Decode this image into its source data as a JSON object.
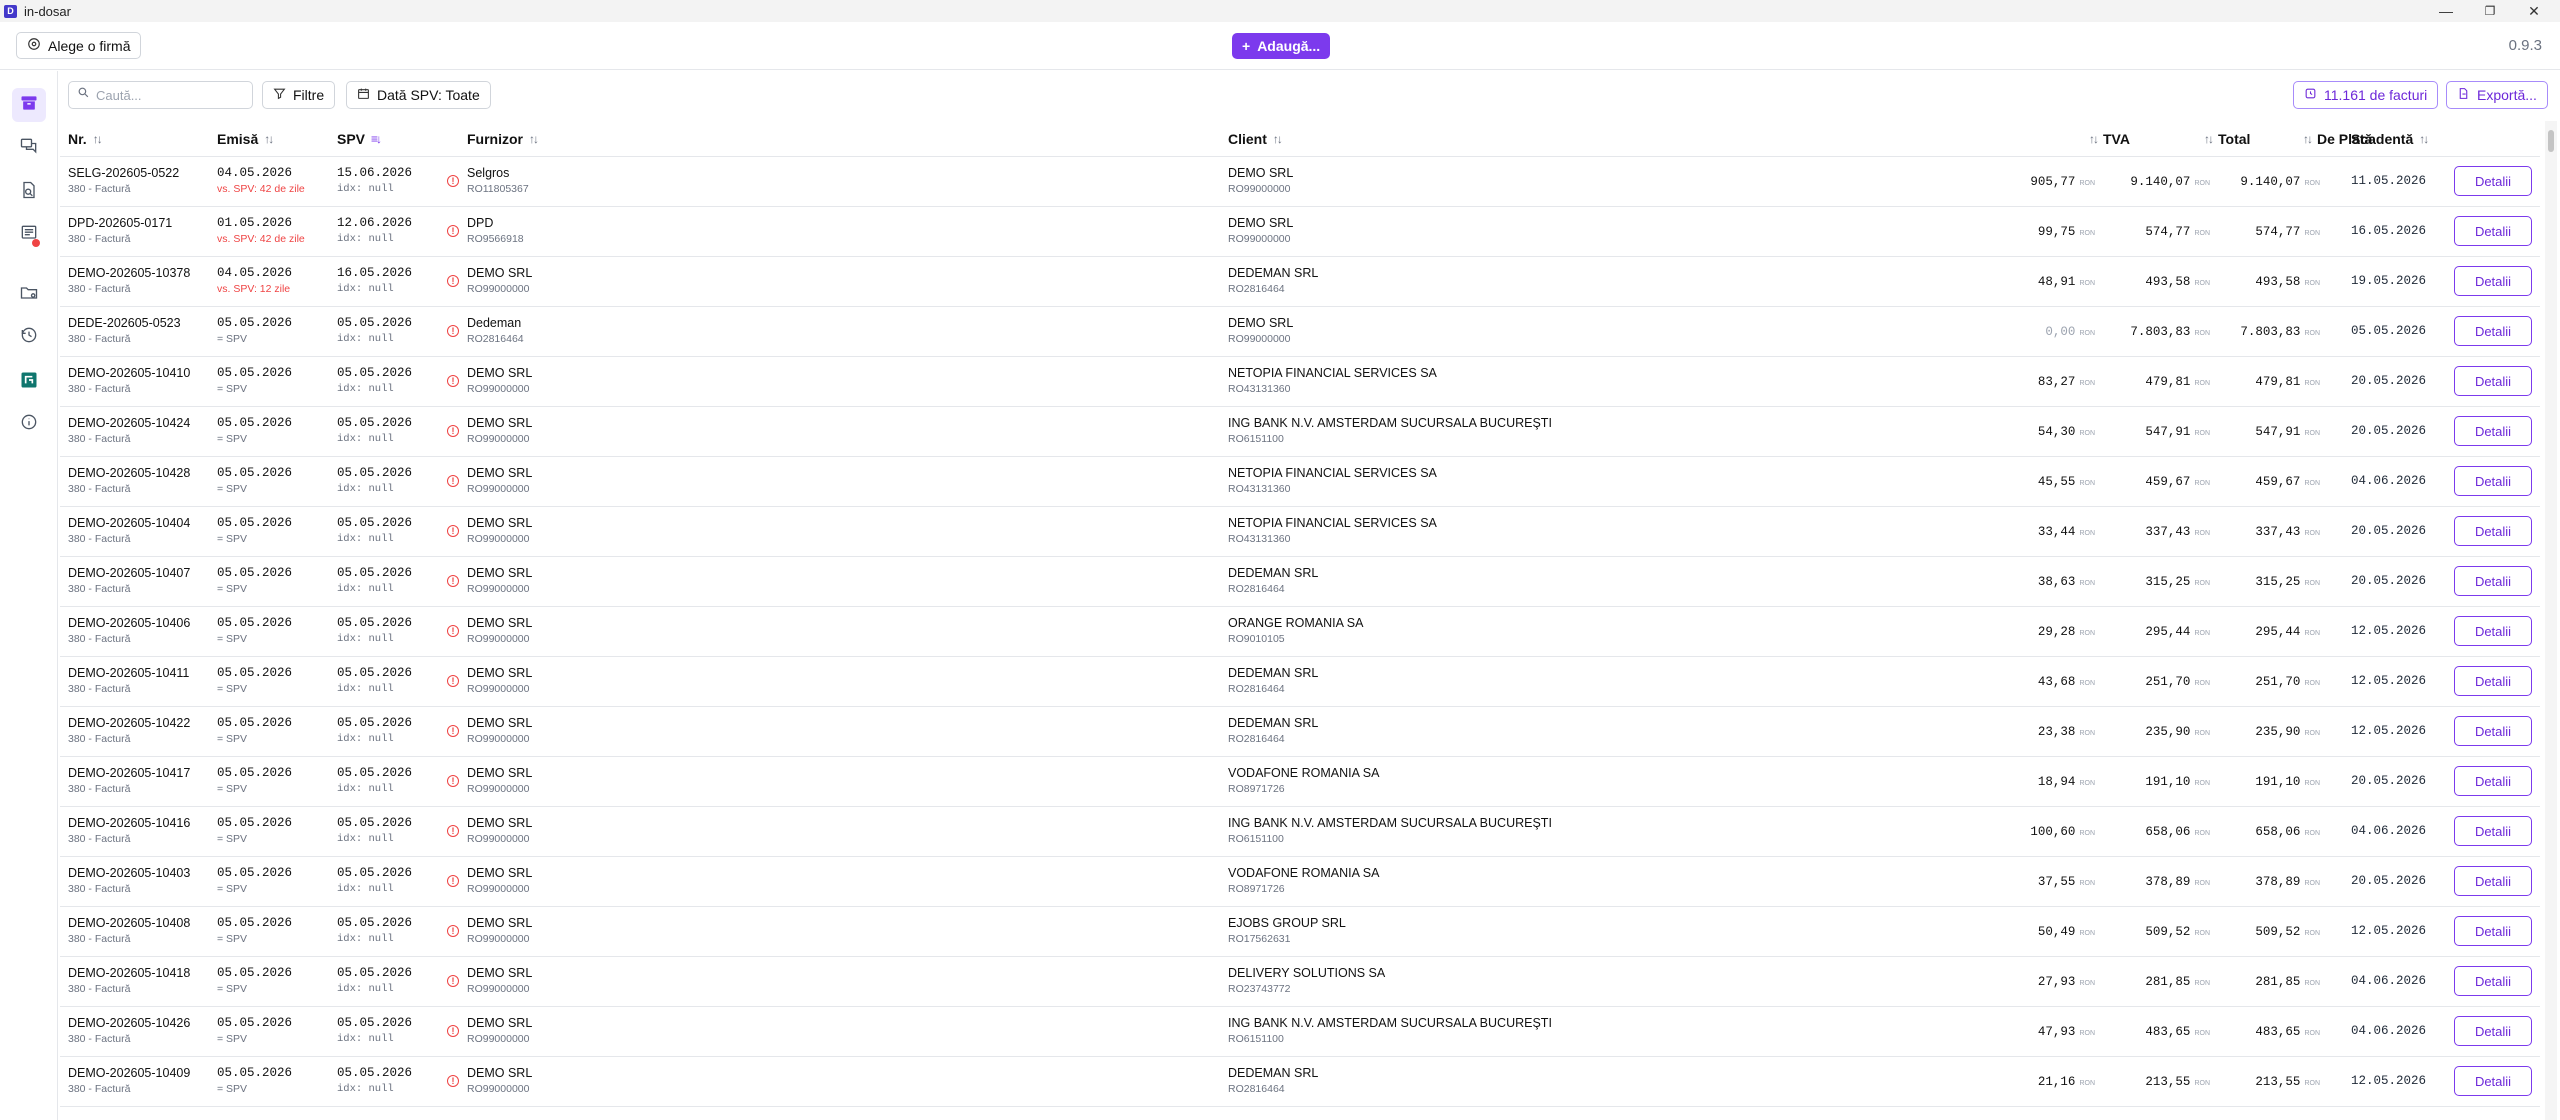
{
  "window": {
    "title": "in-dosar",
    "min": "—",
    "max": "❐",
    "close": "✕"
  },
  "topbar": {
    "company_button": "Alege o firmă",
    "add_button": "Adaugă...",
    "version": "0.9.3"
  },
  "toolbar": {
    "search_placeholder": "Caută...",
    "filters_button": "Filtre",
    "date_button": "Dată SPV: Toate",
    "invoices_count_button": "11.161 de facturi",
    "export_button": "Exportă..."
  },
  "columns": {
    "nr": "Nr.",
    "emisa": "Emisă",
    "spv": "SPV",
    "furnizor": "Furnizor",
    "client": "Client",
    "tva": "TVA",
    "total": "Total",
    "de_plata": "De Plată",
    "scadenta": "Scadentă",
    "sort_icon": "↑↓"
  },
  "currency": "RON",
  "detail_label": "Detalii",
  "rows": [
    {
      "nr": "SELG-202605-0522",
      "type": "380 - Factură",
      "emisa": "04.05.2026",
      "emisa_sub": "vs. SPV: 42 de zile",
      "emisa_warn": true,
      "spv": "15.06.2026",
      "spv_sub": "idx: null",
      "furnizor": "Selgros",
      "furnizor_cui": "RO11805367",
      "client": "DEMO SRL",
      "client_cui": "RO99000000",
      "tva": "905,77",
      "total": "9.140,07",
      "de_plata": "9.140,07",
      "scadenta": "11.05.2026"
    },
    {
      "nr": "DPD-202605-0171",
      "type": "380 - Factură",
      "emisa": "01.05.2026",
      "emisa_sub": "vs. SPV: 42 de zile",
      "emisa_warn": true,
      "spv": "12.06.2026",
      "spv_sub": "idx: null",
      "furnizor": "DPD",
      "furnizor_cui": "RO9566918",
      "client": "DEMO SRL",
      "client_cui": "RO99000000",
      "tva": "99,75",
      "total": "574,77",
      "de_plata": "574,77",
      "scadenta": "16.05.2026"
    },
    {
      "nr": "DEMO-202605-10378",
      "type": "380 - Factură",
      "emisa": "04.05.2026",
      "emisa_sub": "vs. SPV: 12 zile",
      "emisa_warn": true,
      "spv": "16.05.2026",
      "spv_sub": "idx: null",
      "furnizor": "DEMO SRL",
      "furnizor_cui": "RO99000000",
      "client": "DEDEMAN SRL",
      "client_cui": "RO2816464",
      "tva": "48,91",
      "total": "493,58",
      "de_plata": "493,58",
      "scadenta": "19.05.2026"
    },
    {
      "nr": "DEDE-202605-0523",
      "type": "380 - Factură",
      "emisa": "05.05.2026",
      "emisa_sub": "= SPV",
      "emisa_warn": false,
      "spv": "05.05.2026",
      "spv_sub": "idx: null",
      "furnizor": "Dedeman",
      "furnizor_cui": "RO2816464",
      "client": "DEMO SRL",
      "client_cui": "RO99000000",
      "tva": "0,00",
      "tva_zero": true,
      "total": "7.803,83",
      "de_plata": "7.803,83",
      "scadenta": "05.05.2026"
    },
    {
      "nr": "DEMO-202605-10410",
      "type": "380 - Factură",
      "emisa": "05.05.2026",
      "emisa_sub": "= SPV",
      "emisa_warn": false,
      "spv": "05.05.2026",
      "spv_sub": "idx: null",
      "furnizor": "DEMO SRL",
      "furnizor_cui": "RO99000000",
      "client": "NETOPIA FINANCIAL SERVICES SA",
      "client_cui": "RO43131360",
      "tva": "83,27",
      "total": "479,81",
      "de_plata": "479,81",
      "scadenta": "20.05.2026"
    },
    {
      "nr": "DEMO-202605-10424",
      "type": "380 - Factură",
      "emisa": "05.05.2026",
      "emisa_sub": "= SPV",
      "emisa_warn": false,
      "spv": "05.05.2026",
      "spv_sub": "idx: null",
      "furnizor": "DEMO SRL",
      "furnizor_cui": "RO99000000",
      "client": "ING BANK N.V. AMSTERDAM SUCURSALA BUCUREŞTI",
      "client_cui": "RO6151100",
      "tva": "54,30",
      "total": "547,91",
      "de_plata": "547,91",
      "scadenta": "20.05.2026"
    },
    {
      "nr": "DEMO-202605-10428",
      "type": "380 - Factură",
      "emisa": "05.05.2026",
      "emisa_sub": "= SPV",
      "emisa_warn": false,
      "spv": "05.05.2026",
      "spv_sub": "idx: null",
      "furnizor": "DEMO SRL",
      "furnizor_cui": "RO99000000",
      "client": "NETOPIA FINANCIAL SERVICES SA",
      "client_cui": "RO43131360",
      "tva": "45,55",
      "total": "459,67",
      "de_plata": "459,67",
      "scadenta": "04.06.2026"
    },
    {
      "nr": "DEMO-202605-10404",
      "type": "380 - Factură",
      "emisa": "05.05.2026",
      "emisa_sub": "= SPV",
      "emisa_warn": false,
      "spv": "05.05.2026",
      "spv_sub": "idx: null",
      "furnizor": "DEMO SRL",
      "furnizor_cui": "RO99000000",
      "client": "NETOPIA FINANCIAL SERVICES SA",
      "client_cui": "RO43131360",
      "tva": "33,44",
      "total": "337,43",
      "de_plata": "337,43",
      "scadenta": "20.05.2026"
    },
    {
      "nr": "DEMO-202605-10407",
      "type": "380 - Factură",
      "emisa": "05.05.2026",
      "emisa_sub": "= SPV",
      "emisa_warn": false,
      "spv": "05.05.2026",
      "spv_sub": "idx: null",
      "furnizor": "DEMO SRL",
      "furnizor_cui": "RO99000000",
      "client": "DEDEMAN SRL",
      "client_cui": "RO2816464",
      "tva": "38,63",
      "total": "315,25",
      "de_plata": "315,25",
      "scadenta": "20.05.2026"
    },
    {
      "nr": "DEMO-202605-10406",
      "type": "380 - Factură",
      "emisa": "05.05.2026",
      "emisa_sub": "= SPV",
      "emisa_warn": false,
      "spv": "05.05.2026",
      "spv_sub": "idx: null",
      "furnizor": "DEMO SRL",
      "furnizor_cui": "RO99000000",
      "client": "ORANGE ROMANIA SA",
      "client_cui": "RO9010105",
      "tva": "29,28",
      "total": "295,44",
      "de_plata": "295,44",
      "scadenta": "12.05.2026"
    },
    {
      "nr": "DEMO-202605-10411",
      "type": "380 - Factură",
      "emisa": "05.05.2026",
      "emisa_sub": "= SPV",
      "emisa_warn": false,
      "spv": "05.05.2026",
      "spv_sub": "idx: null",
      "furnizor": "DEMO SRL",
      "furnizor_cui": "RO99000000",
      "client": "DEDEMAN SRL",
      "client_cui": "RO2816464",
      "tva": "43,68",
      "total": "251,70",
      "de_plata": "251,70",
      "scadenta": "12.05.2026"
    },
    {
      "nr": "DEMO-202605-10422",
      "type": "380 - Factură",
      "emisa": "05.05.2026",
      "emisa_sub": "= SPV",
      "emisa_warn": false,
      "spv": "05.05.2026",
      "spv_sub": "idx: null",
      "furnizor": "DEMO SRL",
      "furnizor_cui": "RO99000000",
      "client": "DEDEMAN SRL",
      "client_cui": "RO2816464",
      "tva": "23,38",
      "total": "235,90",
      "de_plata": "235,90",
      "scadenta": "12.05.2026"
    },
    {
      "nr": "DEMO-202605-10417",
      "type": "380 - Factură",
      "emisa": "05.05.2026",
      "emisa_sub": "= SPV",
      "emisa_warn": false,
      "spv": "05.05.2026",
      "spv_sub": "idx: null",
      "furnizor": "DEMO SRL",
      "furnizor_cui": "RO99000000",
      "client": "VODAFONE ROMANIA SA",
      "client_cui": "RO8971726",
      "tva": "18,94",
      "total": "191,10",
      "de_plata": "191,10",
      "scadenta": "20.05.2026"
    },
    {
      "nr": "DEMO-202605-10416",
      "type": "380 - Factură",
      "emisa": "05.05.2026",
      "emisa_sub": "= SPV",
      "emisa_warn": false,
      "spv": "05.05.2026",
      "spv_sub": "idx: null",
      "furnizor": "DEMO SRL",
      "furnizor_cui": "RO99000000",
      "client": "ING BANK N.V. AMSTERDAM SUCURSALA BUCUREŞTI",
      "client_cui": "RO6151100",
      "tva": "100,60",
      "total": "658,06",
      "de_plata": "658,06",
      "scadenta": "04.06.2026"
    },
    {
      "nr": "DEMO-202605-10403",
      "type": "380 - Factură",
      "emisa": "05.05.2026",
      "emisa_sub": "= SPV",
      "emisa_warn": false,
      "spv": "05.05.2026",
      "spv_sub": "idx: null",
      "furnizor": "DEMO SRL",
      "furnizor_cui": "RO99000000",
      "client": "VODAFONE ROMANIA SA",
      "client_cui": "RO8971726",
      "tva": "37,55",
      "total": "378,89",
      "de_plata": "378,89",
      "scadenta": "20.05.2026"
    },
    {
      "nr": "DEMO-202605-10408",
      "type": "380 - Factură",
      "emisa": "05.05.2026",
      "emisa_sub": "= SPV",
      "emisa_warn": false,
      "spv": "05.05.2026",
      "spv_sub": "idx: null",
      "furnizor": "DEMO SRL",
      "furnizor_cui": "RO99000000",
      "client": "EJOBS GROUP SRL",
      "client_cui": "RO17562631",
      "tva": "50,49",
      "total": "509,52",
      "de_plata": "509,52",
      "scadenta": "12.05.2026"
    },
    {
      "nr": "DEMO-202605-10418",
      "type": "380 - Factură",
      "emisa": "05.05.2026",
      "emisa_sub": "= SPV",
      "emisa_warn": false,
      "spv": "05.05.2026",
      "spv_sub": "idx: null",
      "furnizor": "DEMO SRL",
      "furnizor_cui": "RO99000000",
      "client": "DELIVERY SOLUTIONS SA",
      "client_cui": "RO23743772",
      "tva": "27,93",
      "total": "281,85",
      "de_plata": "281,85",
      "scadenta": "04.06.2026"
    },
    {
      "nr": "DEMO-202605-10426",
      "type": "380 - Factură",
      "emisa": "05.05.2026",
      "emisa_sub": "= SPV",
      "emisa_warn": false,
      "spv": "05.05.2026",
      "spv_sub": "idx: null",
      "furnizor": "DEMO SRL",
      "furnizor_cui": "RO99000000",
      "client": "ING BANK N.V. AMSTERDAM SUCURSALA BUCUREŞTI",
      "client_cui": "RO6151100",
      "tva": "47,93",
      "total": "483,65",
      "de_plata": "483,65",
      "scadenta": "04.06.2026"
    },
    {
      "nr": "DEMO-202605-10409",
      "type": "380 - Factură",
      "emisa": "05.05.2026",
      "emisa_sub": "= SPV",
      "emisa_warn": false,
      "spv": "05.05.2026",
      "spv_sub": "idx: null",
      "furnizor": "DEMO SRL",
      "furnizor_cui": "RO99000000",
      "client": "DEDEMAN SRL",
      "client_cui": "RO2816464",
      "tva": "21,16",
      "total": "213,55",
      "de_plata": "213,55",
      "scadenta": "12.05.2026"
    }
  ],
  "sidebar": {
    "items": [
      {
        "icon": "archive-icon",
        "active": true
      },
      {
        "icon": "messages-icon"
      },
      {
        "icon": "document-search-icon"
      },
      {
        "icon": "receipt-alert-icon",
        "badge": true
      },
      {
        "icon": "folder-settings-icon"
      },
      {
        "icon": "history-icon"
      },
      {
        "icon": "brand-logo-icon",
        "accent": "#0f766e"
      },
      {
        "icon": "info-icon"
      }
    ]
  },
  "colors": {
    "accent": "#7c3aed",
    "danger": "#ef4444",
    "brand": "#0f766e"
  }
}
